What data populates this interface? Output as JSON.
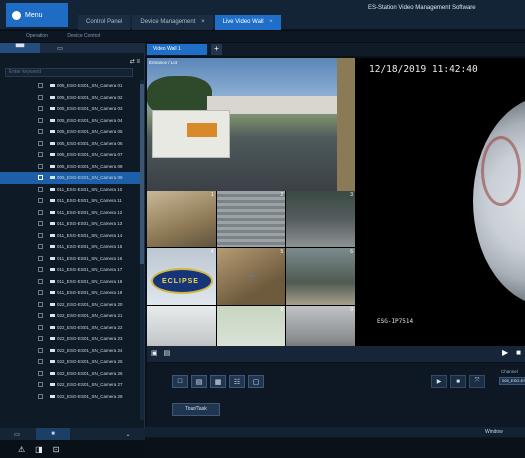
{
  "titlebar": {
    "menu_label": "Menu",
    "app_title": "ES-Station Video Management Software",
    "tabs": [
      {
        "label": "Control Panel",
        "active": false
      },
      {
        "label": "Device Management",
        "active": false,
        "close": "×"
      },
      {
        "label": "Live Video Wall",
        "active": true,
        "close": "×"
      }
    ]
  },
  "breadcrumb": [
    "Operation",
    "Device Control"
  ],
  "sidebar": {
    "tabs": [
      "▀▀",
      "▭"
    ],
    "tools": "⇄ ≡",
    "search_placeholder": "Enter keyword",
    "cameras": [
      "005_ESG-ES01_SN_Camera 01",
      "005_ESG-ES01_SN_Camera 02",
      "005_ESG-ES01_SN_Camera 03",
      "005_ESG-ES01_SN_Camera 04",
      "005_ESG-ES01_SN_Camera 05",
      "005_ESG-ES01_SN_Camera 06",
      "005_ESG-ES01_SN_Camera 07",
      "005_ESG-ES01_SN_Camera 08",
      "005_ESG-ES01_SN_Camera 09",
      "011_ESG-ES01_SN_Camera 10",
      "011_ESG-ES01_SN_Camera 11",
      "011_ESG-ES01_SN_Camera 12",
      "011_ESG-ES01_SN_Camera 13",
      "011_ESG-ES01_SN_Camera 14",
      "011_ESG-ES01_SN_Camera 15",
      "011_ESG-ES01_SN_Camera 16",
      "011_ESG-ES01_SN_Camera 17",
      "011_ESG-ES01_SN_Camera 18",
      "011_ESG-ES01_SN_Camera 19",
      "022_ESG-ES01_SN_Camera 20",
      "022_ESG-ES01_SN_Camera 21",
      "022_ESG-ES01_SN_Camera 22",
      "022_ESG-ES01_SN_Camera 23",
      "022_ESG-ES01_SN_Camera 24",
      "022_ESG-ES01_SN_Camera 25",
      "022_ESG-ES01_SN_Camera 26",
      "022_ESG-ES01_SN_Camera 27",
      "022_ESG-ES01_SN_Camera 28"
    ],
    "selected_index": 8,
    "bottom_tabs": [
      "▭",
      "■",
      "⌄"
    ]
  },
  "bottom_icons": [
    "⚠",
    "◨",
    "⊡"
  ],
  "main": {
    "view_tab": "Video Wall 1",
    "add_label": "+",
    "big_cam_label": "Entrance / Lot",
    "timestamp": "12/18/2019 11:42:40",
    "fisheye_name": "ESG-IP7514",
    "grid_numbers": [
      "1",
      "2",
      "3",
      "4",
      "5",
      "6",
      "7",
      "8",
      "9"
    ],
    "eclipse_text": "ECLIPSE",
    "ctrl_left": [
      "▣",
      "▤"
    ],
    "ctrl_right": [
      "▶",
      "■"
    ],
    "layout_buttons": [
      "□",
      "▤",
      "▦",
      "☷",
      "▢"
    ],
    "tour_label": "Tour/Task",
    "play_buttons": [
      "▶",
      "■",
      "⤧"
    ],
    "side_field_label": "Channel",
    "side_field_value": "005_ESG-ES",
    "window_label": "Window"
  }
}
